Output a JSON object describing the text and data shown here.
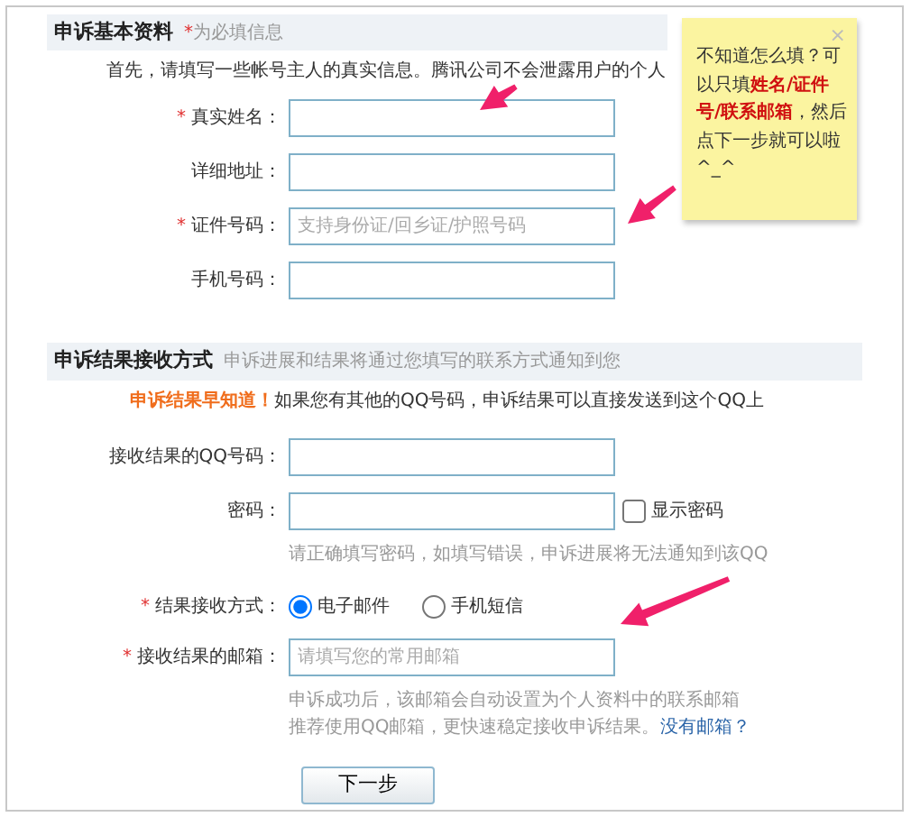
{
  "sections": [
    {
      "title": "申诉基本资料",
      "required_mark": "*",
      "note": "为必填信息",
      "intro": "首先，请填写一些帐号主人的真实信息。腾讯公司不会泄露用户的个人",
      "fields": [
        {
          "kind": "text",
          "label": "真实姓名：",
          "required": true
        },
        {
          "kind": "text",
          "label": "详细地址：",
          "required": false
        },
        {
          "kind": "text",
          "label": "证件号码：",
          "required": true,
          "placeholder": "支持身份证/回乡证/护照号码"
        },
        {
          "kind": "text",
          "label": "手机号码：",
          "required": false
        }
      ]
    },
    {
      "title": "申诉结果接收方式",
      "note": "申诉进展和结果将通过您填写的联系方式通知到您",
      "lead": "申诉结果早知道！",
      "intro": "如果您有其他的QQ号码，申诉结果可以直接发送到这个QQ上",
      "fields": [
        {
          "kind": "text",
          "label": "接收结果的QQ号码：",
          "required": false
        },
        {
          "kind": "password",
          "label": "密码：",
          "required": false,
          "toggle": {
            "label": "显示密码",
            "checked": false
          },
          "hints": [
            "请正确填写密码，如填写错误，申诉进展将无法通知到该QQ"
          ]
        },
        {
          "kind": "radio",
          "label": "结果接收方式：",
          "required": true,
          "options": [
            {
              "label": "电子邮件",
              "selected": true
            },
            {
              "label": "手机短信",
              "selected": false
            }
          ]
        },
        {
          "kind": "text",
          "label": "接收结果的邮箱：",
          "required": true,
          "placeholder": "请填写您的常用邮箱",
          "hints": [
            "申诉成功后，该邮箱会自动设置为个人资料中的联系邮箱",
            "推荐使用QQ邮箱，更快速稳定接收申诉结果。"
          ],
          "link": "没有邮箱？"
        }
      ]
    }
  ],
  "next_button": "下一步",
  "tip": {
    "close": "×",
    "text": "不知道怎么填？可以只填**姓名/证件号/联系邮箱**，然后点下一步就可以啦^_^"
  }
}
